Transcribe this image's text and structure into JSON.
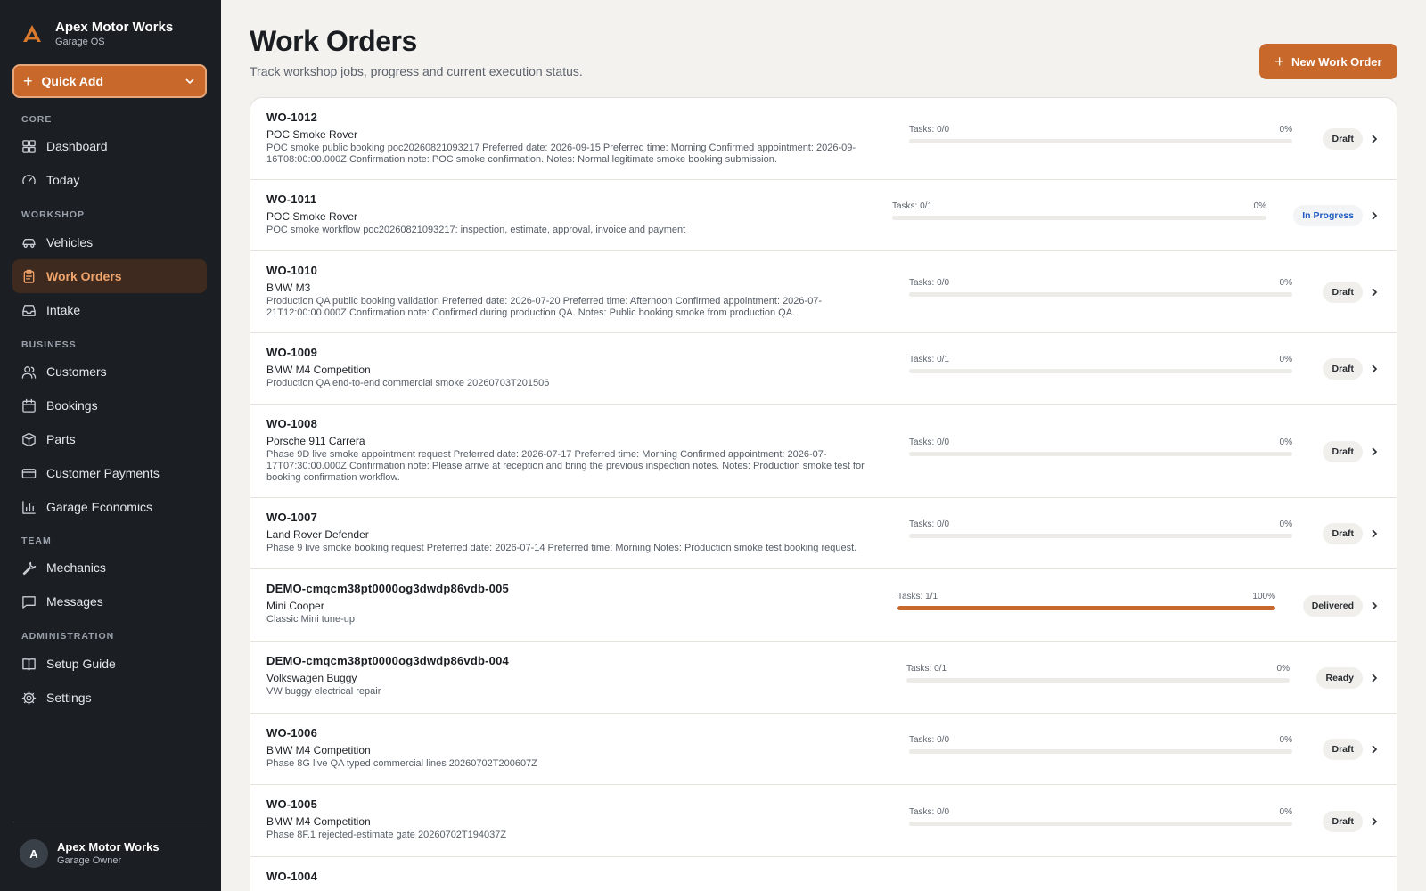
{
  "app": {
    "name": "Apex Motor Works",
    "subtitle": "Garage OS",
    "accent": "#c8682b"
  },
  "quick_add": {
    "label": "Quick Add"
  },
  "nav": {
    "sections": [
      {
        "title": "CORE",
        "items": [
          {
            "label": "Dashboard",
            "icon": "grid-icon"
          },
          {
            "label": "Today",
            "icon": "gauge-icon"
          }
        ]
      },
      {
        "title": "WORKSHOP",
        "items": [
          {
            "label": "Vehicles",
            "icon": "car-icon"
          },
          {
            "label": "Work Orders",
            "icon": "clipboard-icon",
            "active": true
          },
          {
            "label": "Intake",
            "icon": "inbox-icon"
          }
        ]
      },
      {
        "title": "BUSINESS",
        "items": [
          {
            "label": "Customers",
            "icon": "users-icon"
          },
          {
            "label": "Bookings",
            "icon": "calendar-icon"
          },
          {
            "label": "Parts",
            "icon": "box-icon"
          },
          {
            "label": "Customer Payments",
            "icon": "credit-card-icon"
          },
          {
            "label": "Garage Economics",
            "icon": "bar-chart-icon"
          }
        ]
      },
      {
        "title": "TEAM",
        "items": [
          {
            "label": "Mechanics",
            "icon": "wrench-icon"
          },
          {
            "label": "Messages",
            "icon": "message-icon"
          }
        ]
      },
      {
        "title": "ADMINISTRATION",
        "items": [
          {
            "label": "Setup Guide",
            "icon": "book-icon"
          },
          {
            "label": "Settings",
            "icon": "gear-icon"
          }
        ]
      }
    ]
  },
  "user": {
    "initial": "A",
    "name": "Apex Motor Works",
    "role": "Garage Owner"
  },
  "page": {
    "title": "Work Orders",
    "subtitle": "Track workshop jobs, progress and current execution status.",
    "new_button": "New Work Order"
  },
  "work_orders": [
    {
      "id": "WO-1012",
      "vehicle": "POC Smoke Rover",
      "description": "POC smoke public booking poc20260821093217 Preferred date: 2026-09-15 Preferred time: Morning Confirmed appointment: 2026-09-16T08:00:00.000Z Confirmation note: POC smoke confirmation. Notes: Normal legitimate smoke booking submission.",
      "tasks": "Tasks: 0/0",
      "percent": "0%",
      "progress": 0,
      "status": "Draft"
    },
    {
      "id": "WO-1011",
      "vehicle": "POC Smoke Rover",
      "description": "POC smoke workflow poc20260821093217: inspection, estimate, approval, invoice and payment",
      "tasks": "Tasks: 0/1",
      "percent": "0%",
      "progress": 0,
      "status": "In Progress"
    },
    {
      "id": "WO-1010",
      "vehicle": "BMW M3",
      "description": "Production QA public booking validation Preferred date: 2026-07-20 Preferred time: Afternoon Confirmed appointment: 2026-07-21T12:00:00.000Z Confirmation note: Confirmed during production QA. Notes: Public booking smoke from production QA.",
      "tasks": "Tasks: 0/0",
      "percent": "0%",
      "progress": 0,
      "status": "Draft"
    },
    {
      "id": "WO-1009",
      "vehicle": "BMW M4 Competition",
      "description": "Production QA end-to-end commercial smoke 20260703T201506",
      "tasks": "Tasks: 0/1",
      "percent": "0%",
      "progress": 0,
      "status": "Draft"
    },
    {
      "id": "WO-1008",
      "vehicle": "Porsche 911 Carrera",
      "description": "Phase 9D live smoke appointment request Preferred date: 2026-07-17 Preferred time: Morning Confirmed appointment: 2026-07-17T07:30:00.000Z Confirmation note: Please arrive at reception and bring the previous inspection notes. Notes: Production smoke test for booking confirmation workflow.",
      "tasks": "Tasks: 0/0",
      "percent": "0%",
      "progress": 0,
      "status": "Draft"
    },
    {
      "id": "WO-1007",
      "vehicle": "Land Rover Defender",
      "description": "Phase 9 live smoke booking request Preferred date: 2026-07-14 Preferred time: Morning Notes: Production smoke test booking request.",
      "tasks": "Tasks: 0/0",
      "percent": "0%",
      "progress": 0,
      "status": "Draft"
    },
    {
      "id": "DEMO-cmqcm38pt0000og3dwdp86vdb-005",
      "vehicle": "Mini Cooper",
      "description": "Classic Mini tune-up",
      "tasks": "Tasks: 1/1",
      "percent": "100%",
      "progress": 1,
      "status": "Delivered"
    },
    {
      "id": "DEMO-cmqcm38pt0000og3dwdp86vdb-004",
      "vehicle": "Volkswagen Buggy",
      "description": "VW buggy electrical repair",
      "tasks": "Tasks: 0/1",
      "percent": "0%",
      "progress": 0,
      "status": "Ready"
    },
    {
      "id": "WO-1006",
      "vehicle": "BMW M4 Competition",
      "description": "Phase 8G live QA typed commercial lines 20260702T200607Z",
      "tasks": "Tasks: 0/0",
      "percent": "0%",
      "progress": 0,
      "status": "Draft"
    },
    {
      "id": "WO-1005",
      "vehicle": "BMW M4 Competition",
      "description": "Phase 8F.1 rejected-estimate gate 20260702T194037Z",
      "tasks": "Tasks: 0/0",
      "percent": "0%",
      "progress": 0,
      "status": "Draft"
    },
    {
      "id": "WO-1004",
      "vehicle": "",
      "description": "",
      "tasks": "",
      "percent": "",
      "progress": 0,
      "status": ""
    }
  ]
}
